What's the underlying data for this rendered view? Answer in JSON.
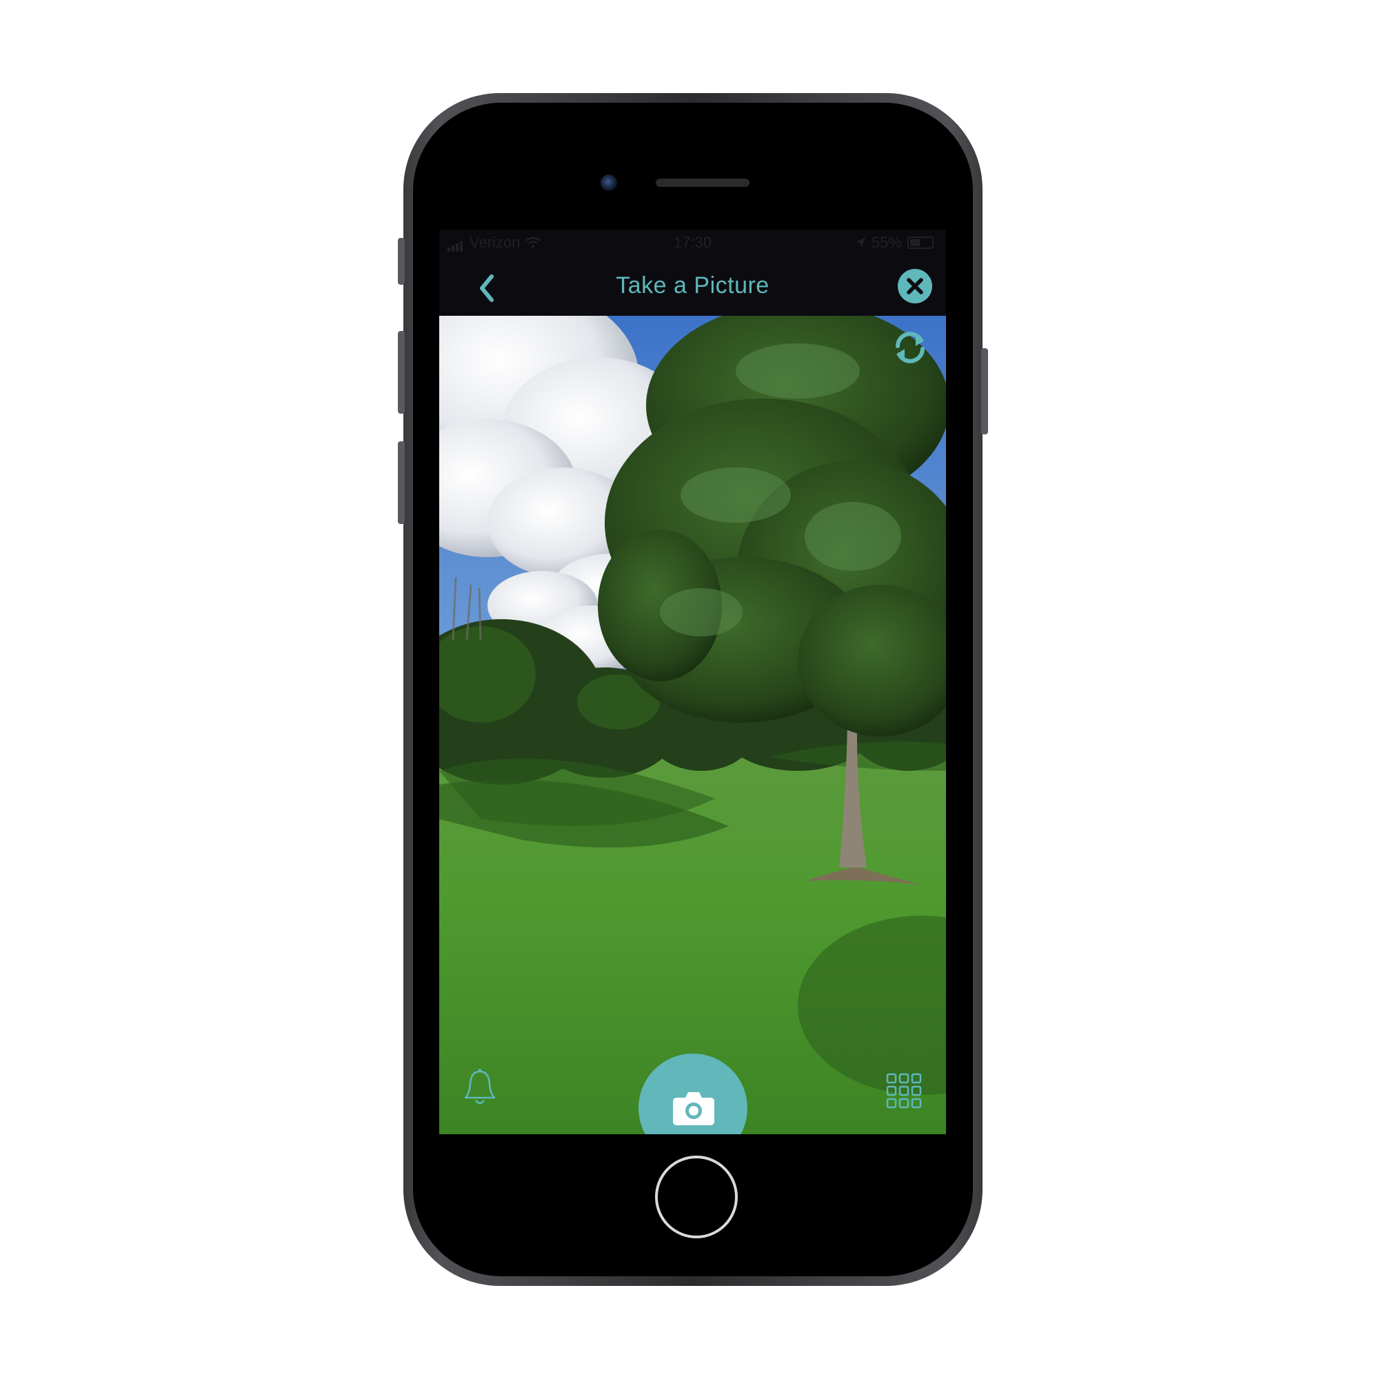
{
  "status_bar": {
    "carrier": "Verizon",
    "time": "17:30",
    "battery_percent": "55%",
    "battery_level": 0.55
  },
  "nav": {
    "title": "Take a Picture",
    "back_icon": "chevron-left-icon",
    "close_icon": "close-circle-icon"
  },
  "camera": {
    "flip_icon": "switch-camera-icon",
    "alerts_icon": "bell-icon",
    "gallery_icon": "grid-icon",
    "shutter_icon": "camera-icon"
  },
  "colors": {
    "accent": "#5fb8bb",
    "nav_background": "#0c0c10",
    "phone_frame": "#3a3a3d"
  }
}
